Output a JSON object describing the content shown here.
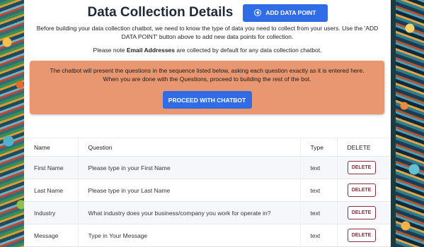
{
  "header": {
    "title": "Data Collection Details",
    "add_button_label": "ADD DATA POINT"
  },
  "intro": {
    "text": "Before building your data collection chatbot, we need to know the type of data you need to collect from your users. Use the 'ADD DATA POINT' button above to add new data points for collection.",
    "note_prefix": "Please note ",
    "note_emphasis": "Email Addresses",
    "note_suffix": " are collected by default for any data collection chatbot."
  },
  "info_box": {
    "line1": "The chatbot will present the questions in the sequence listed below, asking each question exactly as it is entered here.",
    "line2": "When you are done with the Questions, proceed to building the rest of the bot.",
    "proceed_label": "PROCEED WITH CHATBOT",
    "color": "#e99771"
  },
  "table": {
    "headers": {
      "name": "Name",
      "question": "Question",
      "type": "Type",
      "delete": "DELETE"
    },
    "rows": [
      {
        "name": "First Name",
        "question": "Please type in your First Name",
        "type": "text",
        "delete_label": "DELETE"
      },
      {
        "name": "Last Name",
        "question": "Please type in your Last Name",
        "type": "text",
        "delete_label": "DELETE"
      },
      {
        "name": "Industry",
        "question": "What industry does your business/company you work for operate in?",
        "type": "text",
        "delete_label": "DELETE"
      },
      {
        "name": "Message",
        "question": "Type in Your Message",
        "type": "text",
        "delete_label": "DELETE"
      }
    ]
  },
  "colors": {
    "primary": "#2f6ce6",
    "danger": "#8b2f3a"
  }
}
